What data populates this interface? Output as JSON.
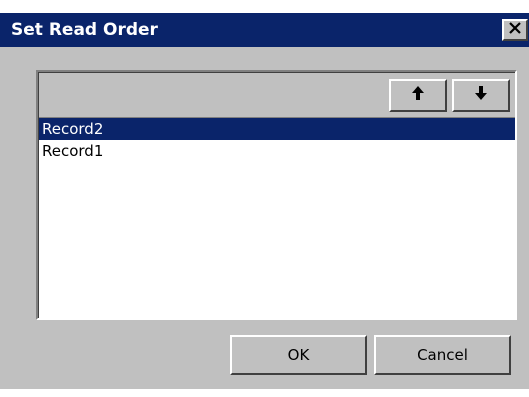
{
  "window": {
    "title": "Set Read Order",
    "close_icon": "close-icon"
  },
  "toolbar": {
    "move_up_icon": "arrow-up-icon",
    "move_down_icon": "arrow-down-icon"
  },
  "list": {
    "items": [
      {
        "label": "Record2",
        "selected": true
      },
      {
        "label": "Record1",
        "selected": false
      }
    ]
  },
  "buttons": {
    "ok_label": "OK",
    "cancel_label": "Cancel"
  },
  "colors": {
    "title_bar": "#0a246a",
    "selection": "#0a246a",
    "face": "#c0c0c0"
  }
}
